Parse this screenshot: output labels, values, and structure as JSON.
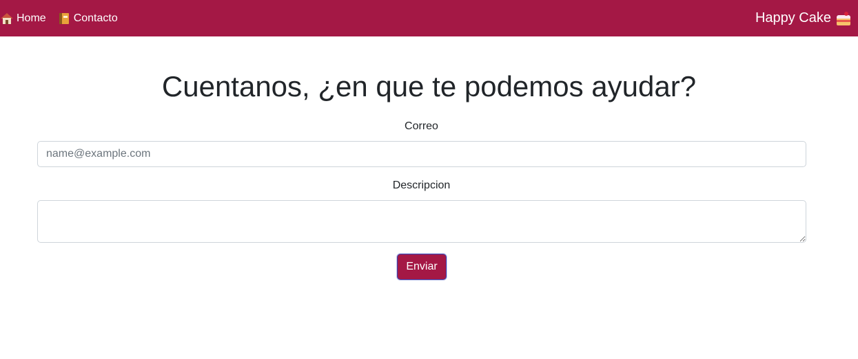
{
  "navbar": {
    "links": [
      {
        "label": "Home",
        "icon": "house-icon"
      },
      {
        "label": "Contacto",
        "icon": "notebook-icon"
      }
    ],
    "brand": {
      "label": "Happy Cake",
      "icon": "cake-icon"
    },
    "background_color": "#a41845"
  },
  "main": {
    "heading": "Cuentanos, ¿en que te podemos ayudar?",
    "email": {
      "label": "Correo",
      "placeholder": "name@example.com",
      "value": ""
    },
    "description": {
      "label": "Descripcion",
      "value": ""
    },
    "submit": {
      "label": "Enviar",
      "color": "#a41845"
    }
  }
}
